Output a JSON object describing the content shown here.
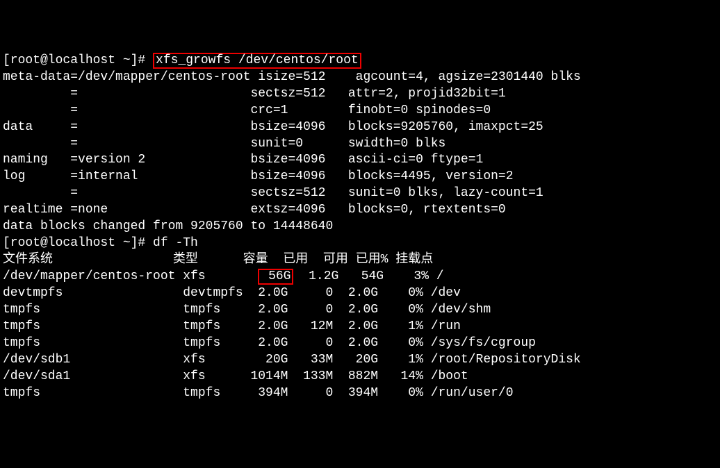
{
  "prompt1_prefix": "[root@localhost ~]# ",
  "cmd1": "xfs_growfs /dev/centos/root",
  "xfs_output": [
    "meta-data=/dev/mapper/centos-root isize=512    agcount=4, agsize=2301440 blks",
    "         =                       sectsz=512   attr=2, projid32bit=1",
    "         =                       crc=1        finobt=0 spinodes=0",
    "data     =                       bsize=4096   blocks=9205760, imaxpct=25",
    "         =                       sunit=0      swidth=0 blks",
    "naming   =version 2              bsize=4096   ascii-ci=0 ftype=1",
    "log      =internal               bsize=4096   blocks=4495, version=2",
    "         =                       sectsz=512   sunit=0 blks, lazy-count=1",
    "realtime =none                   extsz=4096   blocks=0, rtextents=0",
    "data blocks changed from 9205760 to 14448640"
  ],
  "prompt2": "[root@localhost ~]# df -Th",
  "df_header": "文件系统                类型      容量  已用  可用 已用% 挂载点",
  "df_row0_a": "/dev/mapper/centos-root xfs       ",
  "df_row0_size": " 56G",
  "df_row0_b": "  1.2G   54G    3% /",
  "df_rows": [
    "devtmpfs                devtmpfs  2.0G     0  2.0G    0% /dev",
    "tmpfs                   tmpfs     2.0G     0  2.0G    0% /dev/shm",
    "tmpfs                   tmpfs     2.0G   12M  2.0G    1% /run",
    "tmpfs                   tmpfs     2.0G     0  2.0G    0% /sys/fs/cgroup",
    "/dev/sdb1               xfs        20G   33M   20G    1% /root/RepositoryDisk",
    "/dev/sda1               xfs      1014M  133M  882M   14% /boot",
    "tmpfs                   tmpfs     394M     0  394M    0% /run/user/0"
  ],
  "chart_data": {
    "type": "table",
    "title": "df -Th output",
    "columns": [
      "文件系统",
      "类型",
      "容量",
      "已用",
      "可用",
      "已用%",
      "挂载点"
    ],
    "rows": [
      [
        "/dev/mapper/centos-root",
        "xfs",
        "56G",
        "1.2G",
        "54G",
        "3%",
        "/"
      ],
      [
        "devtmpfs",
        "devtmpfs",
        "2.0G",
        "0",
        "2.0G",
        "0%",
        "/dev"
      ],
      [
        "tmpfs",
        "tmpfs",
        "2.0G",
        "0",
        "2.0G",
        "0%",
        "/dev/shm"
      ],
      [
        "tmpfs",
        "tmpfs",
        "2.0G",
        "12M",
        "2.0G",
        "1%",
        "/run"
      ],
      [
        "tmpfs",
        "tmpfs",
        "2.0G",
        "0",
        "2.0G",
        "0%",
        "/sys/fs/cgroup"
      ],
      [
        "/dev/sdb1",
        "xfs",
        "20G",
        "33M",
        "20G",
        "1%",
        "/root/RepositoryDisk"
      ],
      [
        "/dev/sda1",
        "xfs",
        "1014M",
        "133M",
        "882M",
        "14%",
        "/boot"
      ],
      [
        "tmpfs",
        "tmpfs",
        "394M",
        "0",
        "394M",
        "0%",
        "/run/user/0"
      ]
    ]
  }
}
